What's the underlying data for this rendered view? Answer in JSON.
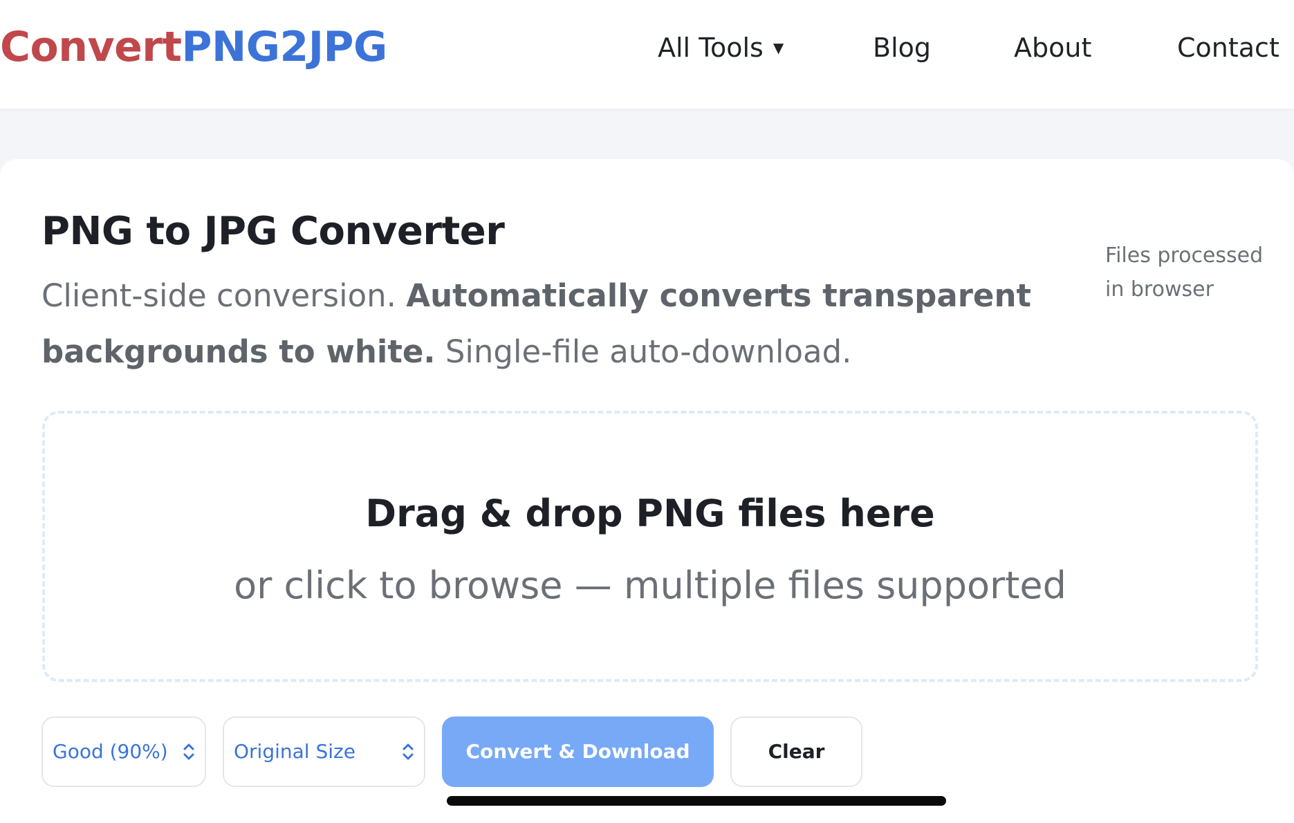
{
  "header": {
    "logo_part1": "Convert",
    "logo_part2": "PNG2JPG",
    "nav": {
      "tools": "All Tools",
      "blog": "Blog",
      "about": "About",
      "contact": "Contact"
    }
  },
  "main": {
    "title": "PNG to JPG Converter",
    "subtitle_part1": "Client-side conversion.",
    "subtitle_bold": "Automatically converts transparent backgrounds to white.",
    "subtitle_part2": "Single-file auto-download.",
    "side_note": "Files processed in browser"
  },
  "dropzone": {
    "title": "Drag & drop PNG files here",
    "subtitle": "or click to browse — multiple files supported"
  },
  "controls": {
    "quality_value": "Good (90%)",
    "size_value": "Original Size",
    "convert_label": "Convert & Download",
    "clear_label": "Clear"
  },
  "colors": {
    "logo_red": "#c0474b",
    "logo_blue": "#3b73d9",
    "primary_button": "#77a9f6"
  },
  "icons": {
    "nav_dropdown": "caret-down-icon",
    "select_arrows": "chevron-up-down-icon"
  }
}
